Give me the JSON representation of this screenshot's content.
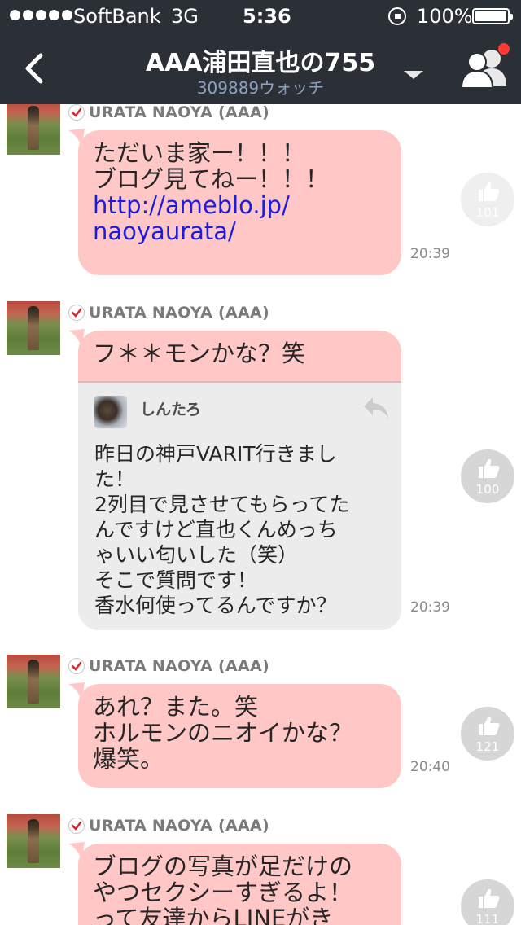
{
  "status_bar": {
    "carrier": "SoftBank",
    "network": "3G",
    "time": "5:36",
    "battery": "100%"
  },
  "header": {
    "title": "AAA浦田直也の755",
    "subtitle": "309889ウォッチ",
    "notification_color": "#ff3a30"
  },
  "colors": {
    "bar_background": "#2b2f36",
    "bubble": "#ffc8c7",
    "link": "#1a1ce0",
    "quote_background": "#ececec"
  },
  "posts": [
    {
      "author": "URATA NAOYA (AAA)",
      "text": "ただいま家ー！！！\nブログ見てねー！！！",
      "link": "http://ameblo.jp/\nnaoyaurata/",
      "time": "20:39",
      "likes": "101"
    },
    {
      "author": "URATA NAOYA (AAA)",
      "text": "フ＊＊モンかな？笑",
      "reply_author": "しんたろ",
      "reply_text": "昨日の神戸VARIT行きまし\nた！\n2列目で見させてもらってた\nんですけど直也くんめっち\nゃいい匂いした（笑）\nそこで質問です！\n香水何使ってるんですか？",
      "time": "20:39",
      "likes": "100"
    },
    {
      "author": "URATA NAOYA (AAA)",
      "text": "あれ？また。笑\nホルモンのニオイかな？\n爆笑。",
      "time": "20:40",
      "likes": "121"
    },
    {
      "author": "URATA NAOYA (AAA)",
      "text": "ブログの写真が足だけの\nやつセクシーすぎるよ！\nって友達からLINEがき",
      "likes": "111"
    }
  ]
}
